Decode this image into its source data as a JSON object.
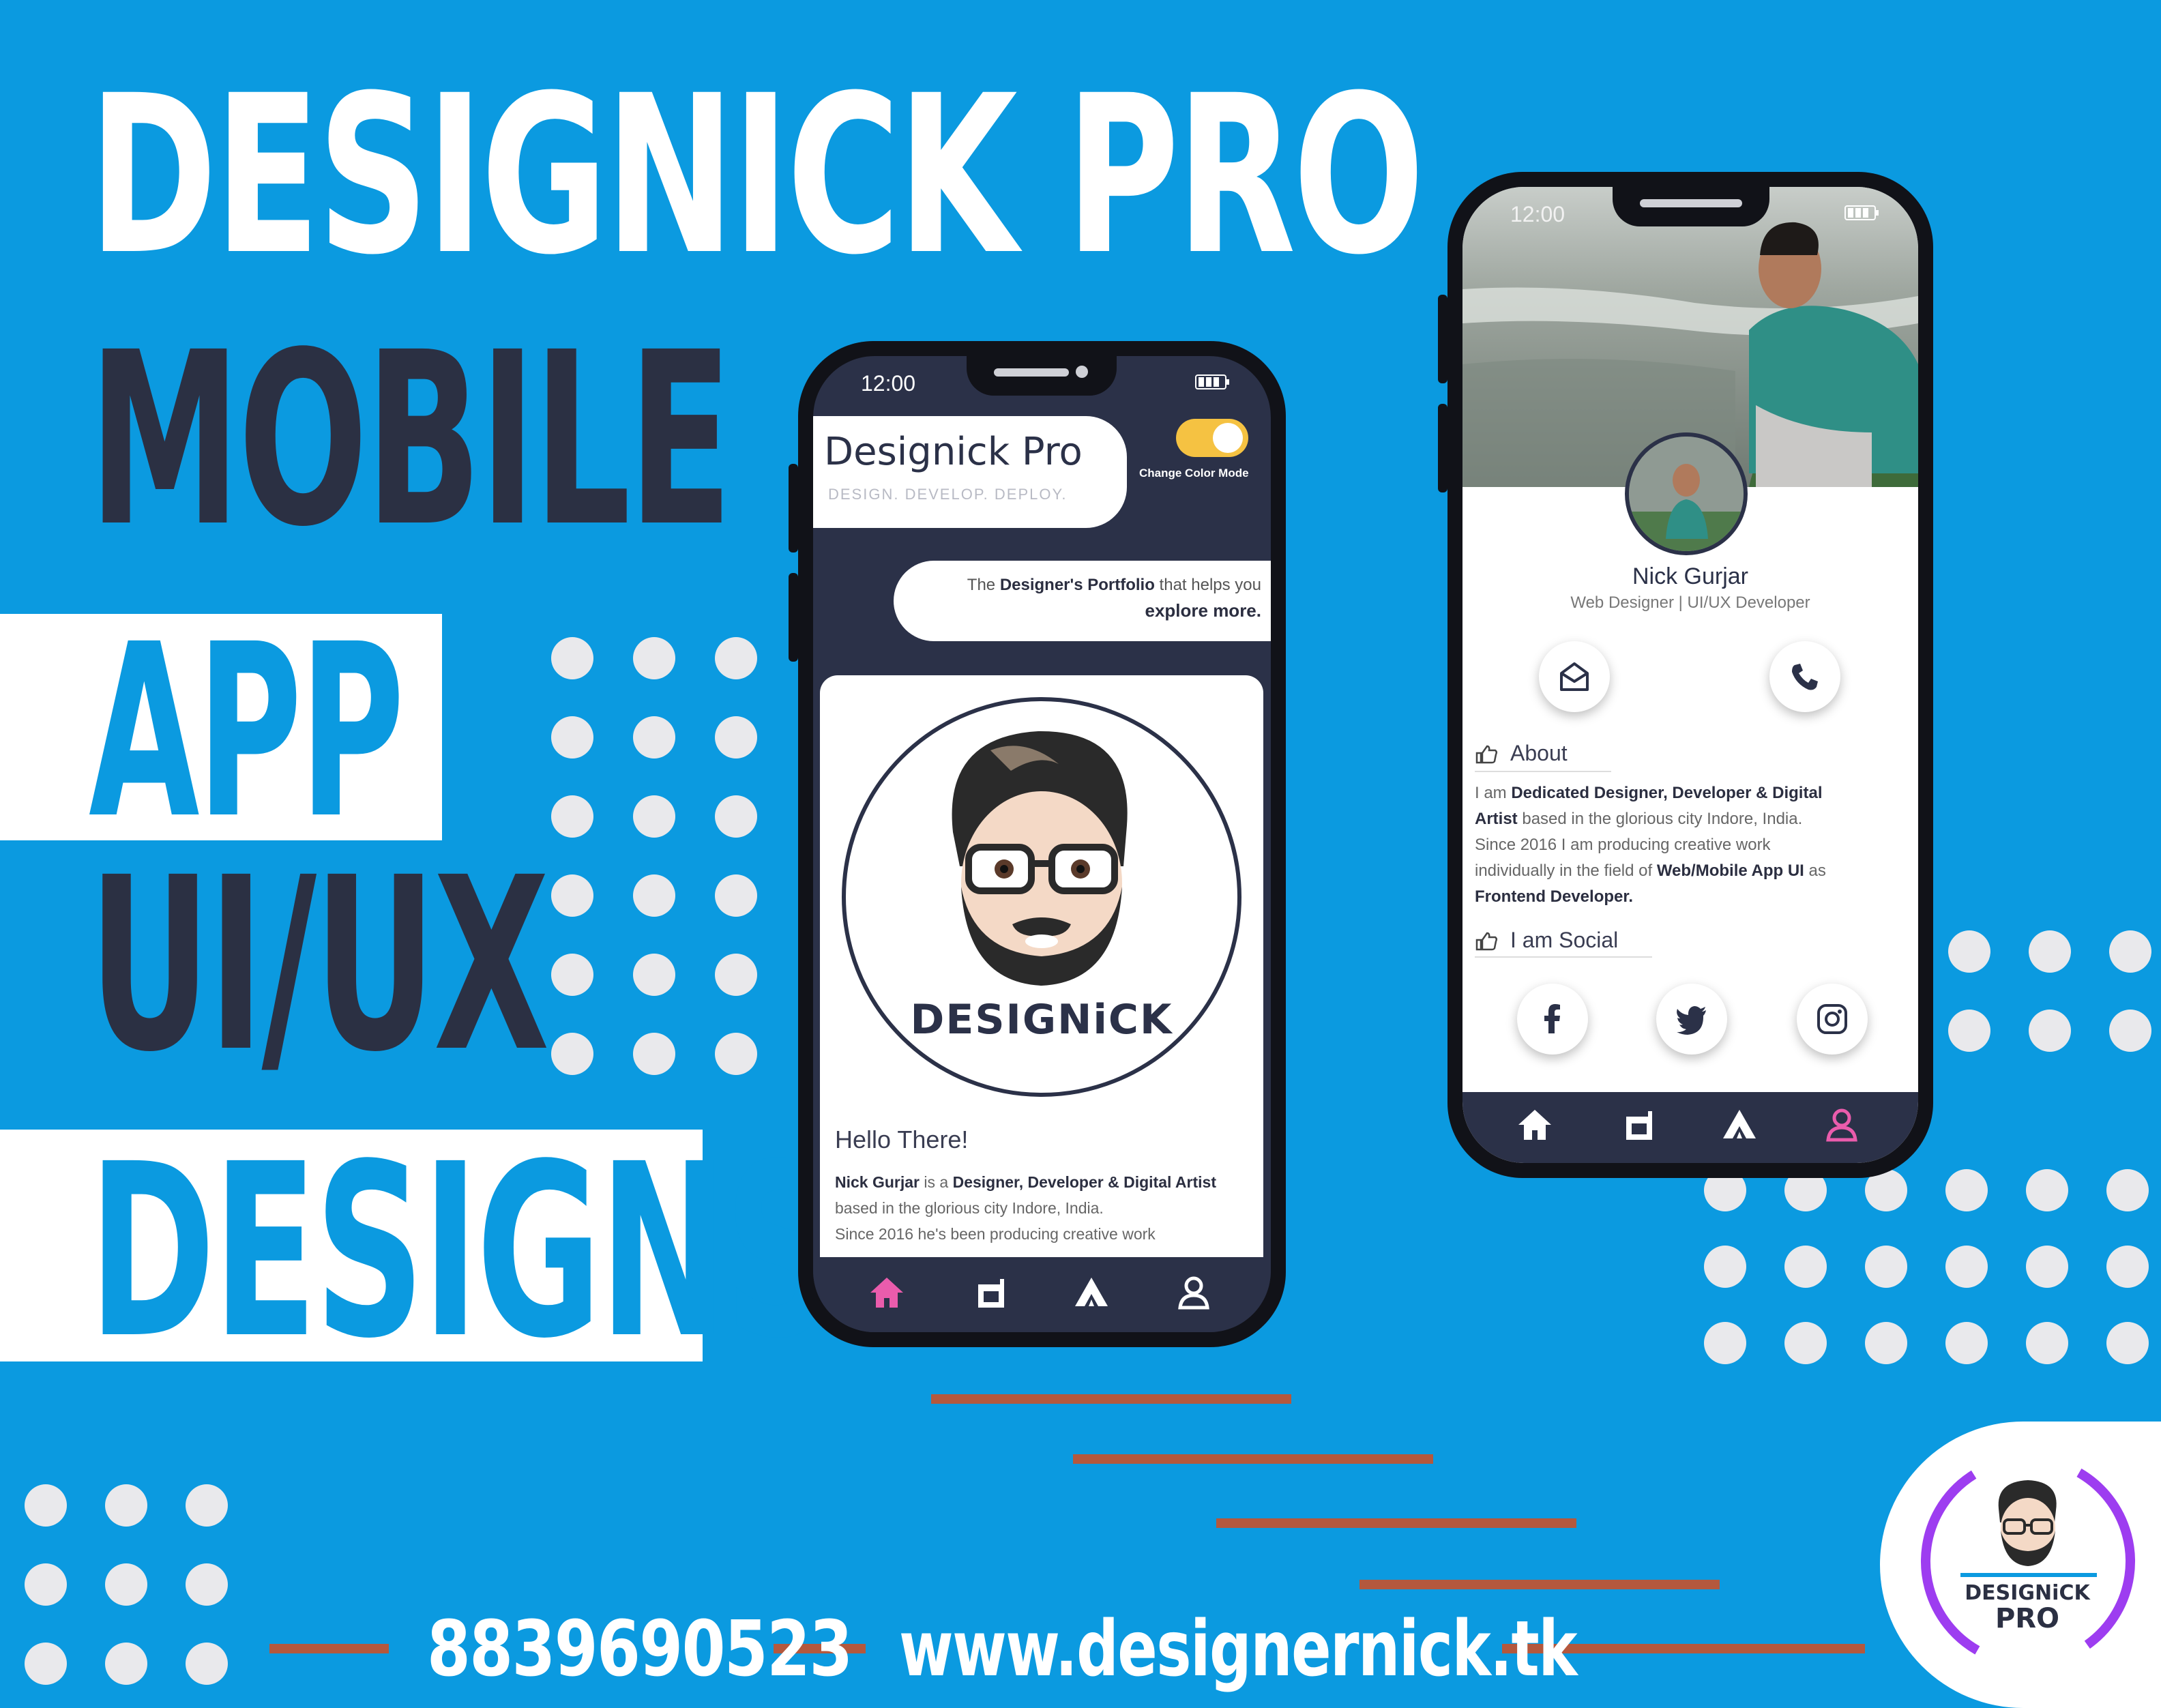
{
  "headline": {
    "line1": "DESIGNICK PRO",
    "line2": "MOBILE",
    "line3": "APP",
    "line4": "UI/UX",
    "line5": "DESIGNS"
  },
  "footer": {
    "phone": "8839690523",
    "website": "www.designernick.tk"
  },
  "logo_badge": {
    "name": "DESIGNiCK",
    "sub": "PRO"
  },
  "phone_left": {
    "status_time": "12:00",
    "app_title": "Designick Pro",
    "tagline": "DESIGN. DEVELOP. DEPLOY.",
    "toggle_label": "Change Color Mode",
    "banner_prefix": "The ",
    "banner_bold": "Designer's Portfolio",
    "banner_mid": " that helps you",
    "banner_line2": "explore more.",
    "logo_text": "DESIGNiCK",
    "greeting": "Hello There!",
    "para_b1": "Nick Gurjar",
    "para_t1": " is a ",
    "para_b2": "Designer, Developer & Digital Artist",
    "para_t2": " based in the glorious city Indore, India.",
    "para_t3": "Since 2016 he's been producing creative work",
    "nav_active": "home",
    "colors": {
      "accent": "#ea5cac",
      "toggle": "#f5c242",
      "dark": "#2b3148"
    }
  },
  "phone_right": {
    "status_time": "12:00",
    "profile_name": "Nick Gurjar",
    "profile_role": "Web Designer | UI/UX Developer",
    "about_heading": "About",
    "about_t1": "I am ",
    "about_b1": "Dedicated Designer, Developer & Digital",
    "about_b1b": "Artist",
    "about_t2": " based in the glorious city Indore, India.",
    "about_t3": "Since 2016 I am producing creative work",
    "about_t4": "individually in the field of ",
    "about_b2": "Web/Mobile App UI",
    "about_t5": " as",
    "about_b3": "Frontend Developer.",
    "social_heading": "I am Social",
    "social": [
      "facebook",
      "twitter",
      "instagram"
    ],
    "nav_active": "profile"
  }
}
